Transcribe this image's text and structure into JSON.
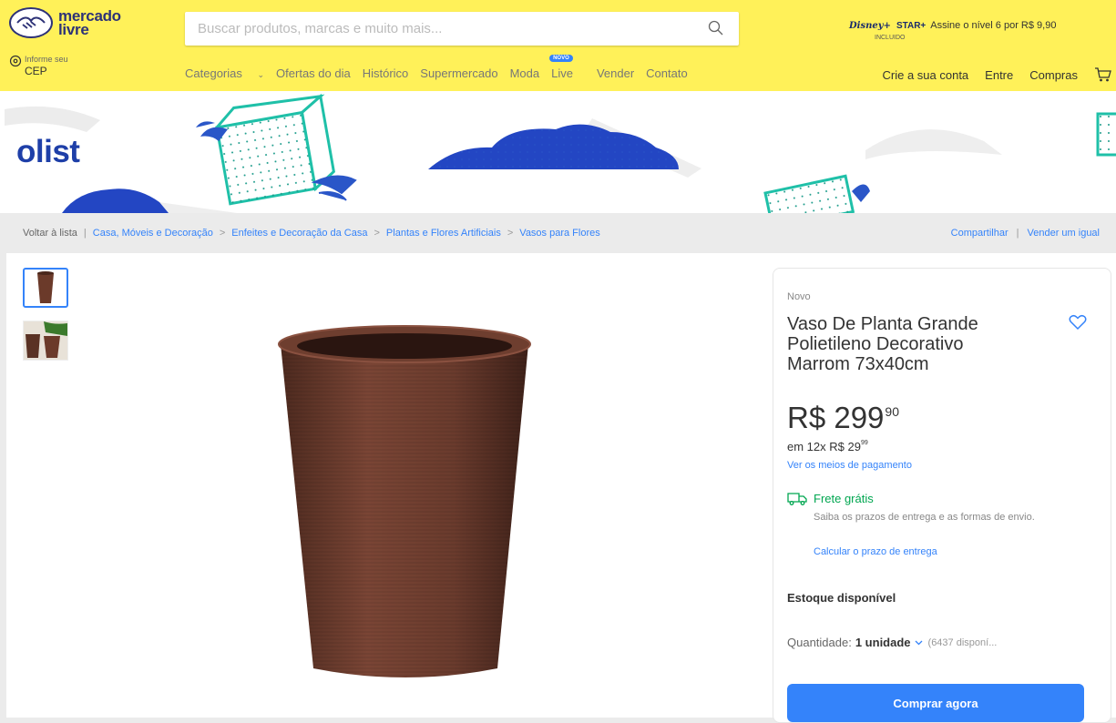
{
  "header": {
    "logo_text_line1": "mercado",
    "logo_text_line2": "livre",
    "search_placeholder": "Buscar produtos, marcas e muito mais...",
    "promo": {
      "brand1": "Disney+",
      "brand2": "STAR+",
      "pack_note": "INCLUIDO",
      "offer": "Assine o nível 6 por R$ 9,90"
    },
    "cep": {
      "line1": "Informe seu",
      "line2": "CEP"
    },
    "nav": [
      "Categorias",
      "Ofertas do dia",
      "Histórico",
      "Supermercado",
      "Moda",
      "Live",
      "Vender",
      "Contato"
    ],
    "live_badge": "NOVO",
    "nav_right": [
      "Crie a sua conta",
      "Entre",
      "Compras"
    ],
    "colors": {
      "header_bg": "#fff159",
      "accent": "#3483fa",
      "green": "#00a650"
    }
  },
  "banner": {
    "brand": "olist"
  },
  "breadcrumb": {
    "back": "Voltar à lista",
    "items": [
      "Casa, Móveis e Decoração",
      "Enfeites e Decoração da Casa",
      "Plantas e Flores Artificiais",
      "Vasos para Flores"
    ],
    "share": "Compartilhar",
    "sell_same": "Vender um igual"
  },
  "product": {
    "condition": "Novo",
    "title": "Vaso De Planta Grande Polietileno Decorativo Marrom 73x40cm",
    "price_int": "R$ 299",
    "price_cents": "90",
    "installments": "em 12x R$ 29",
    "installments_cents": "99",
    "payment_link": "Ver os meios de pagamento",
    "shipping": "Frete grátis",
    "shipping_desc": "Saiba os prazos de entrega e as formas de envio.",
    "calc_link": "Calcular o prazo de entrega",
    "stock": "Estoque disponível",
    "qty_label": "Quantidade:",
    "qty_value": "1 unidade",
    "qty_avail": "(6437 disponí...",
    "buy_label": "Comprar agora"
  }
}
